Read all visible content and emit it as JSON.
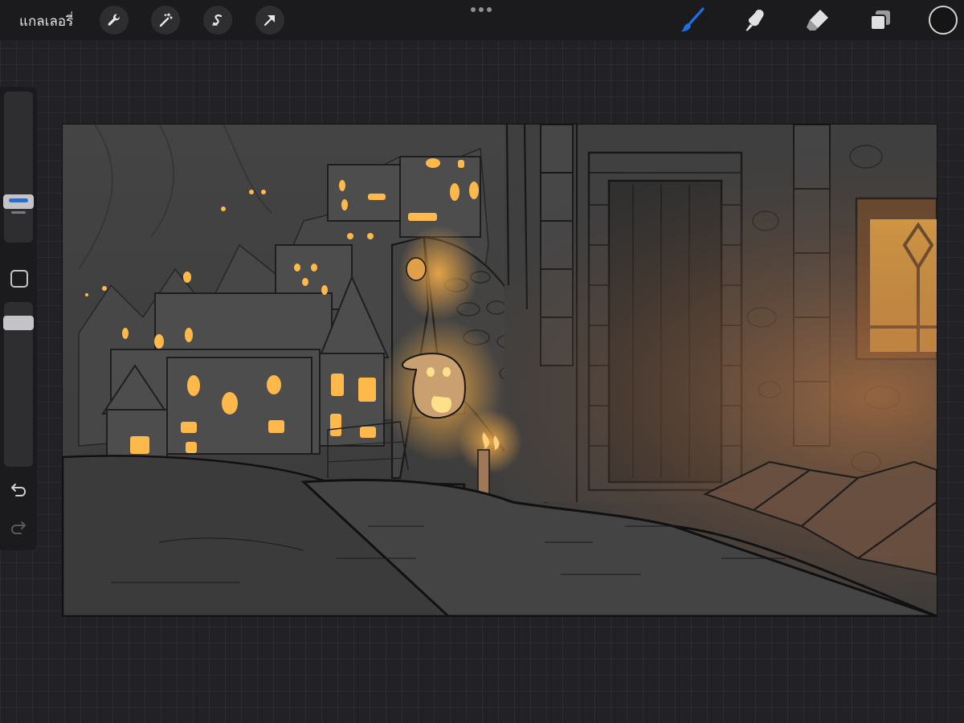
{
  "toolbar": {
    "gallery_label": "แกลเลอรี่",
    "left_tools": [
      "wrench-icon",
      "magic-wand-icon",
      "selection-s-icon",
      "transform-arrow-icon"
    ],
    "right_tools": [
      "brush-icon",
      "smudge-icon",
      "eraser-icon",
      "layers-icon"
    ],
    "active_tool": "brush",
    "active_color": "#151515",
    "accent_color": "#1f6fe0"
  },
  "sidebar": {
    "brush_size": 0.27,
    "opacity": 0.05,
    "modify_icon": "square-icon",
    "undo_icon": "undo-icon",
    "redo_icon": "redo-icon"
  },
  "canvas": {
    "palette": {
      "background": "#3d3d3d",
      "glow": "#ffb347",
      "window_light": "#ffb84a",
      "line": "#141414"
    }
  }
}
